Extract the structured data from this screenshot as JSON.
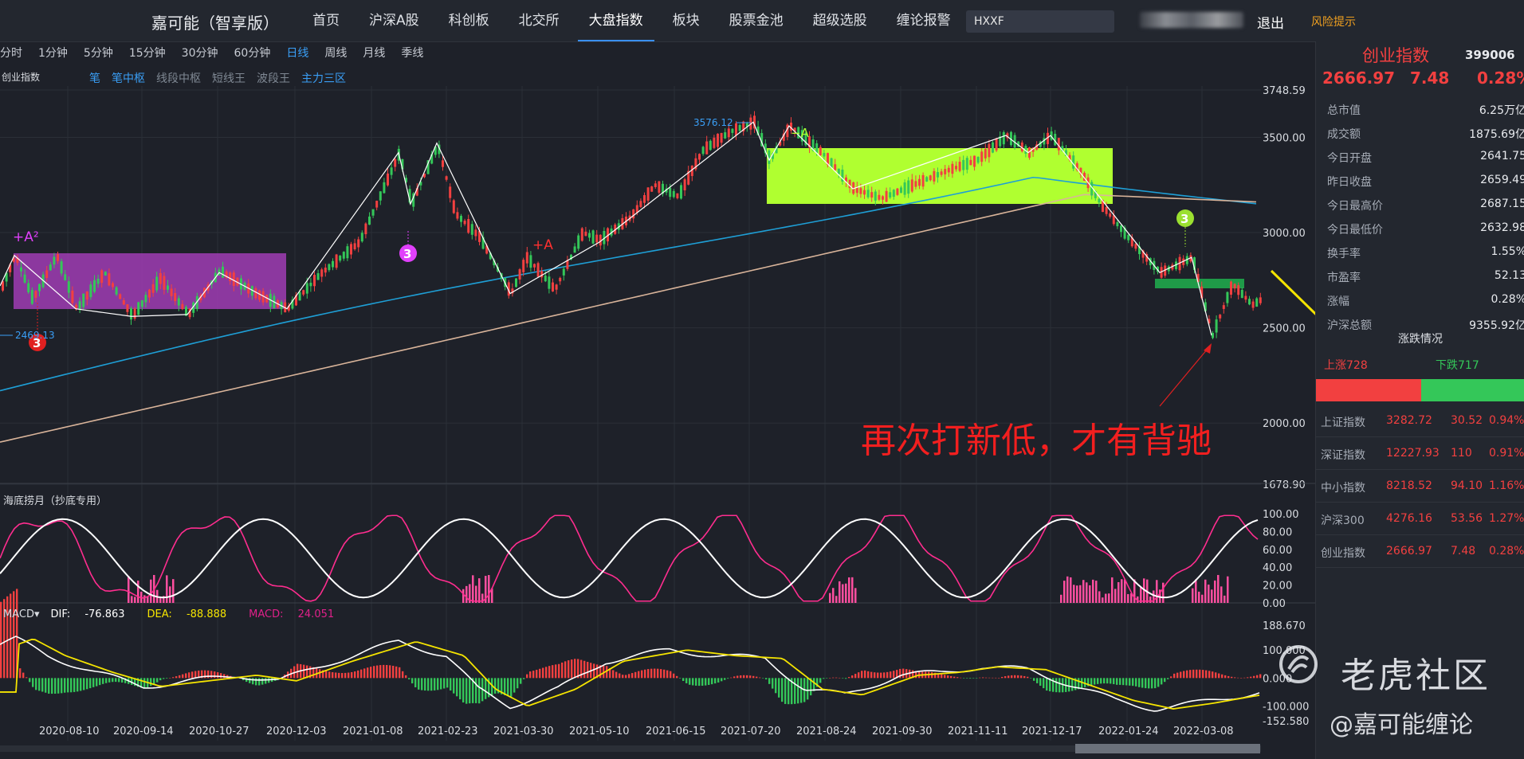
{
  "app": {
    "brand": "嘉可能（智享版）"
  },
  "nav": {
    "items": [
      "首页",
      "沪深A股",
      "科创板",
      "北交所",
      "大盘指数",
      "板块",
      "股票金池",
      "超级选股",
      "缠论报警"
    ],
    "active": "大盘指数"
  },
  "search": {
    "value": "HXXF"
  },
  "header": {
    "logout": "退出",
    "risk": "风险提示"
  },
  "periods": {
    "items": [
      "分时",
      "1分钟",
      "5分钟",
      "15分钟",
      "30分钟",
      "60分钟",
      "日线",
      "周线",
      "月线",
      "季线"
    ],
    "active": "日线"
  },
  "chart_title": "创业指数",
  "tools": [
    "笔",
    "笔中枢",
    "线段中枢",
    "短线王",
    "波段王",
    "主力三区"
  ],
  "chart_data": {
    "type": "candlestick",
    "title": "创业指数",
    "y_ticks": [
      "3748.59",
      "3500.00",
      "3000.00",
      "2500.00",
      "2000.00",
      "1678.90"
    ],
    "ylim": [
      1678.9,
      3748.59
    ],
    "x_ticks": [
      "2020-08-10",
      "2020-09-14",
      "2020-10-27",
      "2020-12-03",
      "2021-01-08",
      "2021-02-23",
      "2021-03-30",
      "2021-05-10",
      "2021-06-15",
      "2021-07-20",
      "2021-08-24",
      "2021-09-30",
      "2021-11-11",
      "2021-12-17",
      "2022-01-24",
      "2022-03-08"
    ],
    "labels": {
      "high": "3576.12",
      "low": "2469.13",
      "plusA2": "+A²",
      "plusA": "+A",
      "minusA": "−A",
      "three": "3"
    },
    "indicator": {
      "name": "海底捞月（抄底专用）",
      "y_ticks": [
        "100.00",
        "80.00",
        "60.00",
        "40.00",
        "20.00",
        "0.00"
      ]
    },
    "macd": {
      "label": "MACD▾",
      "dif_label": "DIF:",
      "dif": "-76.863",
      "dea_label": "DEA:",
      "dea": "-88.888",
      "macd_label": "MACD:",
      "macd": "24.051",
      "y_ticks": [
        "188.670",
        "100.000",
        "0.000",
        "-100.000",
        "-152.580"
      ]
    }
  },
  "annotation": "再次打新低，才有背驰",
  "right_panel": {
    "name": "创业指数",
    "code": "399006",
    "price": "2666.97",
    "change": "7.48",
    "pct": "0.28%",
    "stats": [
      {
        "k": "总市值",
        "v": "6.25万亿"
      },
      {
        "k": "成交额",
        "v": "1875.69亿"
      },
      {
        "k": "今日开盘",
        "v": "2641.75"
      },
      {
        "k": "昨日收盘",
        "v": "2659.49"
      },
      {
        "k": "今日最高价",
        "v": "2687.15"
      },
      {
        "k": "今日最低价",
        "v": "2632.98"
      },
      {
        "k": "换手率",
        "v": "1.55%"
      },
      {
        "k": "市盈率",
        "v": "52.13"
      },
      {
        "k": "涨幅",
        "v": "0.28%"
      },
      {
        "k": "沪深总额",
        "v": "9355.92亿"
      }
    ],
    "section": "涨跌情况",
    "up": "上涨728",
    "down": "下跌717",
    "up_ratio": 0.504,
    "indices": [
      {
        "name": "上证指数",
        "price": "3282.72",
        "chg": "30.52",
        "pct": "0.94%"
      },
      {
        "name": "深证指数",
        "price": "12227.93",
        "chg": "110",
        "pct": "0.91%"
      },
      {
        "name": "中小指数",
        "price": "8218.52",
        "chg": "94.10",
        "pct": "1.16%"
      },
      {
        "name": "沪深300",
        "price": "4276.16",
        "chg": "53.56",
        "pct": "1.27%"
      },
      {
        "name": "创业指数",
        "price": "2666.97",
        "chg": "7.48",
        "pct": "0.28%"
      }
    ]
  },
  "watermark": {
    "title": "老虎社区",
    "sub": "@嘉可能缠论"
  },
  "colors": {
    "up": "#f24040",
    "down": "#34c759",
    "accent": "#3a9ef5",
    "pivot_purple": "#a03cb4",
    "pivot_lime": "#b0ff30",
    "ma_blue": "#1e9fd6",
    "ma_tan": "#d9b49a"
  }
}
